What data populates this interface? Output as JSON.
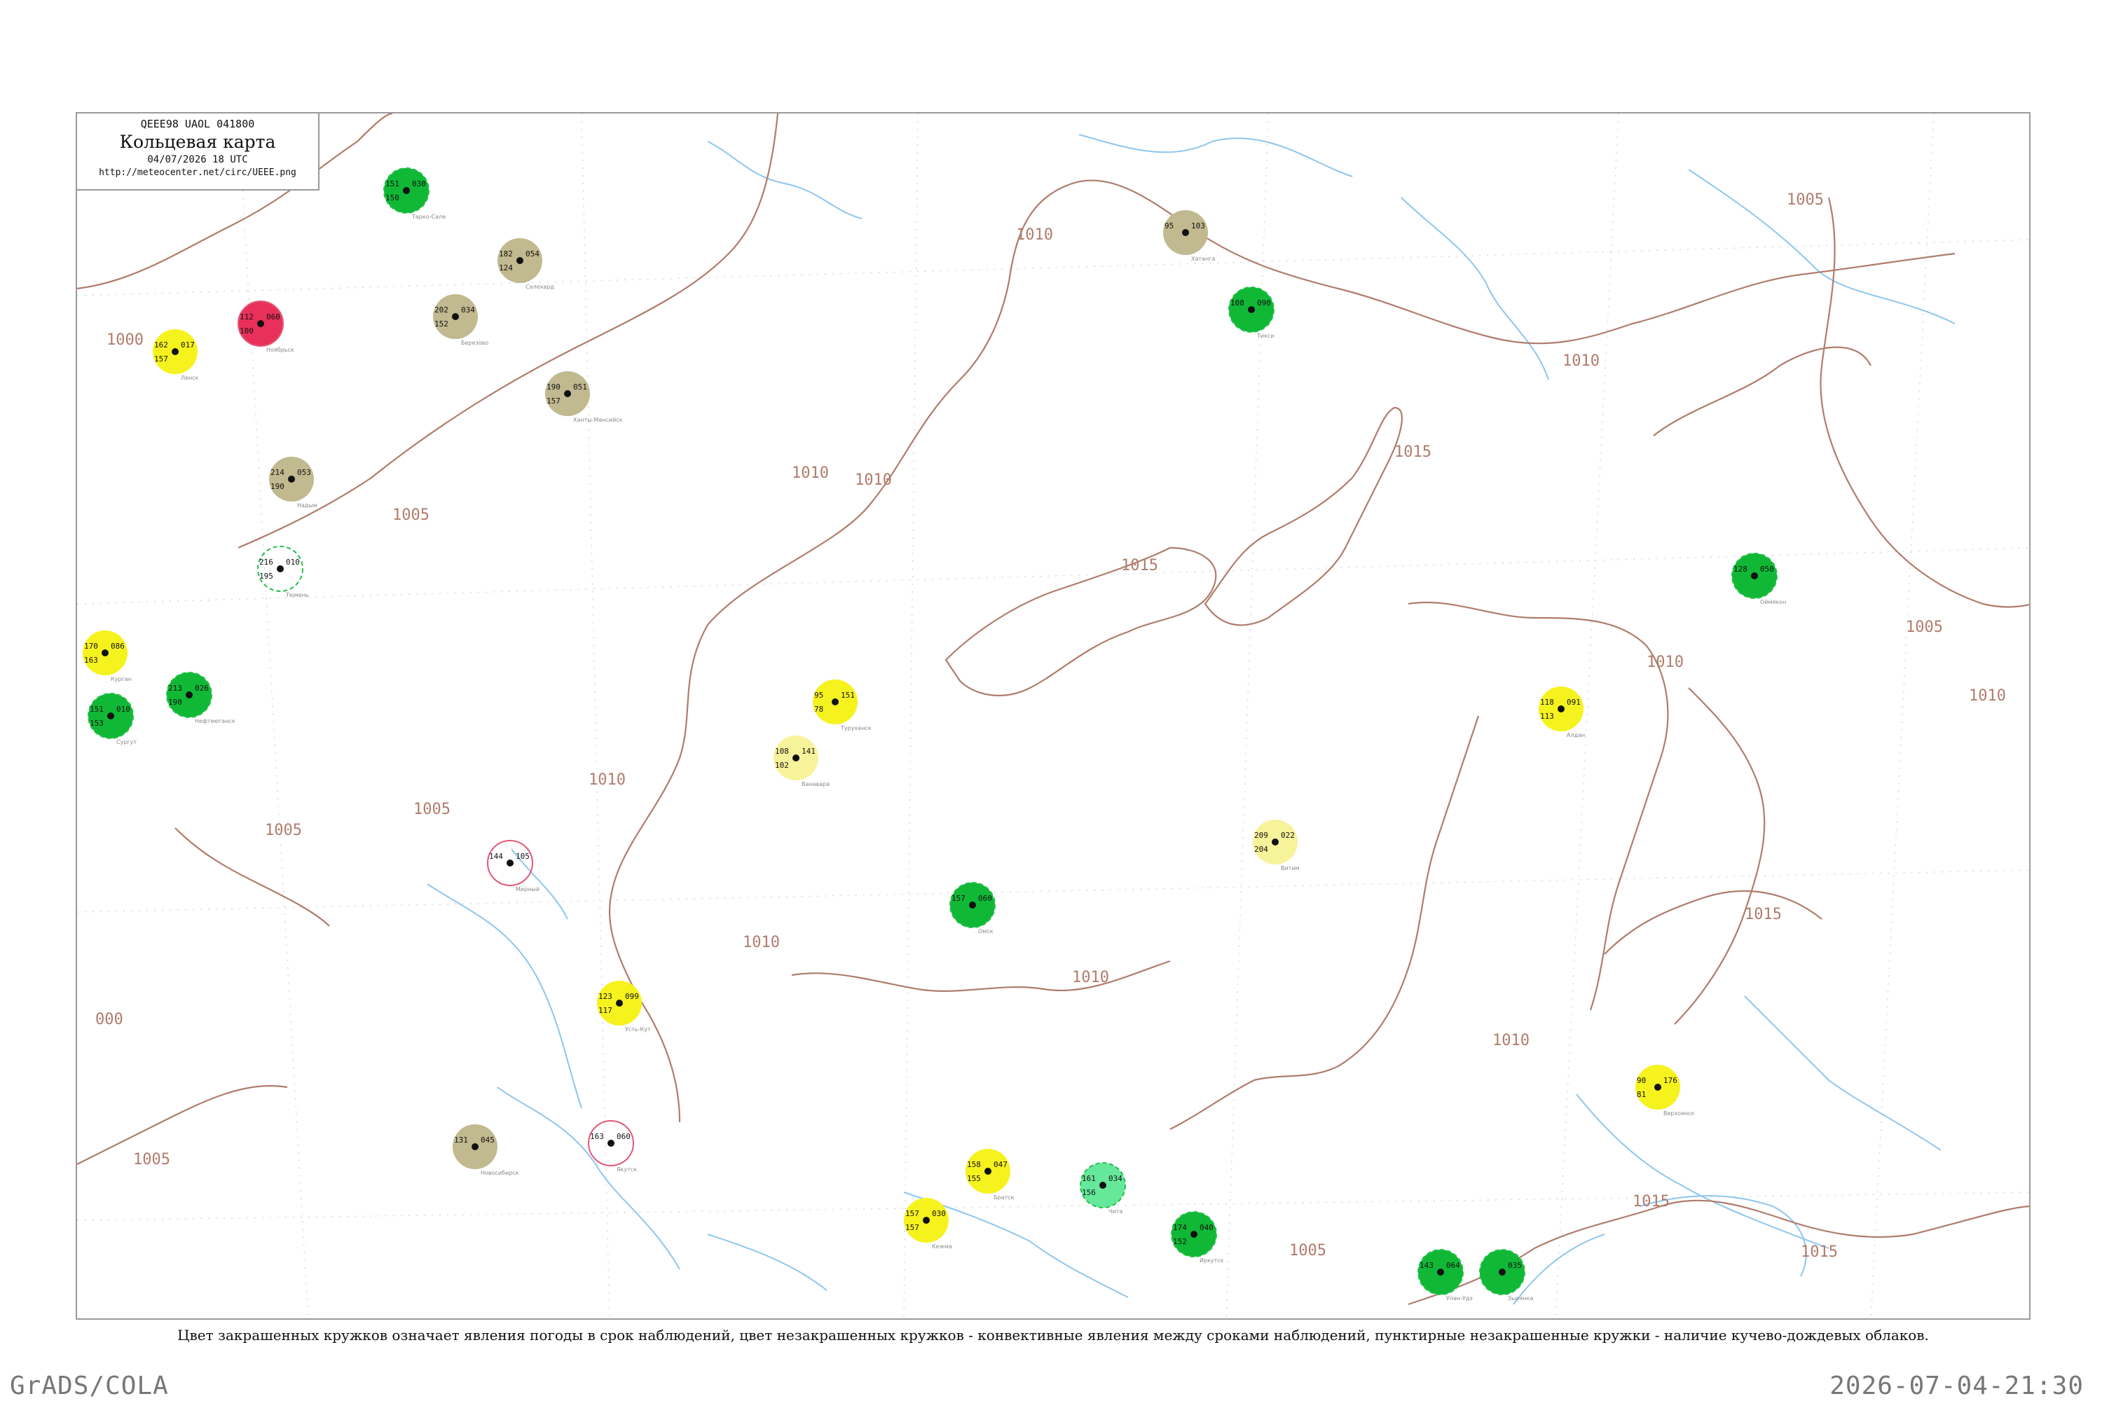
{
  "header": {
    "bulletin_code": "QEEE98  UAOL  041800",
    "title": "Кольцевая карта",
    "datetime": "04/07/2026 18 UTC",
    "url": "http://meteocenter.net/circ/UEEE.png"
  },
  "caption": "Цвет закрашенных кружков означает явления погоды в срок наблюдений, цвет незакрашенных кружков - конвективные явления между сроками наблюдений, пунктирные незакрашенные кружки - наличие кучево-дождевых облаков.",
  "footer": {
    "left": "GrADS/COLA",
    "right": "2026-07-04-21:30"
  },
  "colors": {
    "isobar": "#b07c6c",
    "river": "#8ec6ee",
    "rain_green": "#10b836",
    "showers_light_green": "#66e89a",
    "fog_yellow": "#f6f21e",
    "haze_light_yellow": "#f7f39a",
    "dust_olive": "#c1b98f",
    "thunder_red": "#e8305a",
    "thunder_ring_red": "#e05a78",
    "cb_ring_green": "#22c04a"
  },
  "isobar_labels": [
    "1005",
    "1010",
    "1010",
    "1005",
    "1010",
    "1015",
    "1015",
    "1010",
    "1005",
    "1010",
    "1015",
    "1010",
    "1005",
    "1000",
    "1005",
    "1010",
    "1010",
    "1010",
    "1010",
    "1005",
    "1015",
    "1015",
    "1005",
    "000"
  ],
  "stations": [
    {
      "name": "Тюмень",
      "t": "216",
      "td": "195",
      "p": "010",
      "style": "ring-cb"
    },
    {
      "name": "Курган",
      "t": "170",
      "td": "163",
      "p": "086",
      "style": "fill-yellow"
    },
    {
      "name": "Сургут",
      "t": "151",
      "td": "153",
      "p": "010",
      "style": "fill-green"
    },
    {
      "name": "Нефтеюганск",
      "t": "213",
      "td": "190",
      "p": "026",
      "style": "fill-green"
    },
    {
      "name": "Ханты-Мансийск",
      "t": "190",
      "td": "157",
      "p": "051",
      "style": "fill-olive"
    },
    {
      "name": "Березово",
      "t": "202",
      "td": "152",
      "p": "034",
      "style": "fill-olive"
    },
    {
      "name": "Салехард",
      "t": "182",
      "td": "124",
      "p": "054",
      "style": "fill-olive"
    },
    {
      "name": "Надым",
      "t": "214",
      "td": "190",
      "p": "053",
      "style": "fill-olive"
    },
    {
      "name": "Тарко-Сале",
      "t": "151",
      "td": "150",
      "p": "030",
      "style": "fill-green"
    },
    {
      "name": "Ноябрьск",
      "t": "112",
      "td": "100",
      "p": "060",
      "style": "fill-red"
    },
    {
      "name": "Туруханск",
      "t": "95",
      "td": "78",
      "p": "151",
      "style": "fill-yellow"
    },
    {
      "name": "Ванавара",
      "t": "108",
      "td": "102",
      "p": "141",
      "style": "fill-light-yellow"
    },
    {
      "name": "Хатанга",
      "t": "95",
      "td": "",
      "p": "103",
      "style": "fill-olive"
    },
    {
      "name": "Тикси",
      "t": "108",
      "td": "",
      "p": "090",
      "style": "fill-green"
    },
    {
      "name": "Алдан",
      "t": "118",
      "td": "113",
      "p": "091",
      "style": "fill-yellow"
    },
    {
      "name": "Витим",
      "t": "209",
      "td": "204",
      "p": "022",
      "style": "fill-light-yellow"
    },
    {
      "name": "Усть-Кут",
      "t": "123",
      "td": "117",
      "p": "099",
      "style": "fill-yellow"
    },
    {
      "name": "Братск",
      "t": "158",
      "td": "155",
      "p": "047",
      "style": "fill-yellow"
    },
    {
      "name": "Кежма",
      "t": "157",
      "td": "157",
      "p": "030",
      "style": "fill-yellow"
    },
    {
      "name": "Верхоянск",
      "t": "90",
      "td": "81",
      "p": "176",
      "style": "fill-yellow"
    },
    {
      "name": "Чита",
      "t": "161",
      "td": "156",
      "p": "034",
      "style": "fill-light-green"
    },
    {
      "name": "Иркутск",
      "t": "174",
      "td": "152",
      "p": "040",
      "style": "fill-green"
    },
    {
      "name": "Улан-Удэ",
      "t": "143",
      "td": "",
      "p": "064",
      "style": "fill-green"
    },
    {
      "name": "Оймякон",
      "t": "128",
      "td": "",
      "p": "050",
      "style": "fill-green"
    },
    {
      "name": "Зырянка",
      "t": "",
      "td": "",
      "p": "035",
      "style": "fill-green"
    },
    {
      "name": "Омск",
      "t": "157",
      "td": "",
      "p": "060",
      "style": "fill-green"
    },
    {
      "name": "Новосибирск",
      "t": "131",
      "td": "",
      "p": "045",
      "style": "fill-olive"
    },
    {
      "name": "Якутск",
      "t": "163",
      "td": "",
      "p": "060",
      "style": "ring-red"
    },
    {
      "name": "Мирный",
      "t": "144",
      "td": "",
      "p": "105",
      "style": "ring-red"
    },
    {
      "name": "Ленск",
      "t": "162",
      "td": "157",
      "p": "017",
      "style": "fill-yellow"
    }
  ]
}
